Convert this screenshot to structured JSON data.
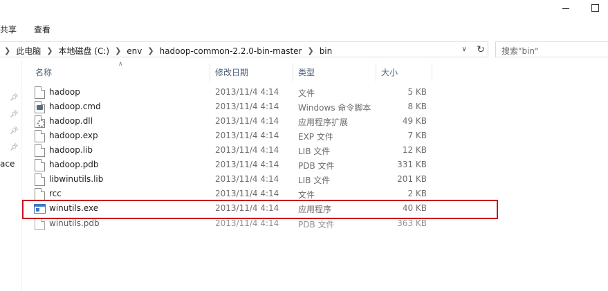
{
  "window": {
    "controls": [
      {
        "name": "minimize",
        "icon": "minimize-icon"
      },
      {
        "name": "maximize",
        "icon": "maximize-icon"
      }
    ]
  },
  "ribbon": {
    "tabs": [
      {
        "label": "共享"
      },
      {
        "label": "查看"
      }
    ]
  },
  "address": {
    "crumbs": [
      "此电脑",
      "本地磁盘 (C:)",
      "env",
      "hadoop-common-2.2.0-bin-master",
      "bin"
    ]
  },
  "search": {
    "placeholder": "搜索\"bin\""
  },
  "nav": {
    "ace_label": "ace"
  },
  "columns": {
    "name": "名称",
    "date": "修改日期",
    "type": "类型",
    "size": "大小"
  },
  "files": [
    {
      "name": "hadoop",
      "date": "2013/11/4 4:14",
      "type": "文件",
      "size": "5 KB",
      "icon": "file-icon"
    },
    {
      "name": "hadoop.cmd",
      "date": "2013/11/4 4:14",
      "type": "Windows 命令脚本",
      "size": "8 KB",
      "icon": "cmd-file-icon"
    },
    {
      "name": "hadoop.dll",
      "date": "2013/11/4 4:14",
      "type": "应用程序扩展",
      "size": "49 KB",
      "icon": "dll-file-icon"
    },
    {
      "name": "hadoop.exp",
      "date": "2013/11/4 4:14",
      "type": "EXP 文件",
      "size": "7 KB",
      "icon": "file-icon"
    },
    {
      "name": "hadoop.lib",
      "date": "2013/11/4 4:14",
      "type": "LIB 文件",
      "size": "12 KB",
      "icon": "file-icon"
    },
    {
      "name": "hadoop.pdb",
      "date": "2013/11/4 4:14",
      "type": "PDB 文件",
      "size": "331 KB",
      "icon": "file-icon"
    },
    {
      "name": "libwinutils.lib",
      "date": "2013/11/4 4:14",
      "type": "LIB 文件",
      "size": "201 KB",
      "icon": "file-icon"
    },
    {
      "name": "rcc",
      "date": "2013/11/4 4:14",
      "type": "文件",
      "size": "2 KB",
      "icon": "file-icon"
    },
    {
      "name": "winutils.exe",
      "date": "2013/11/4 4:14",
      "type": "应用程序",
      "size": "40 KB",
      "icon": "exe-file-icon"
    },
    {
      "name": "winutils.pdb",
      "date": "2013/11/4 4:14",
      "type": "PDB 文件",
      "size": "363 KB",
      "icon": "file-icon"
    }
  ],
  "highlight_color": "#c8101e"
}
